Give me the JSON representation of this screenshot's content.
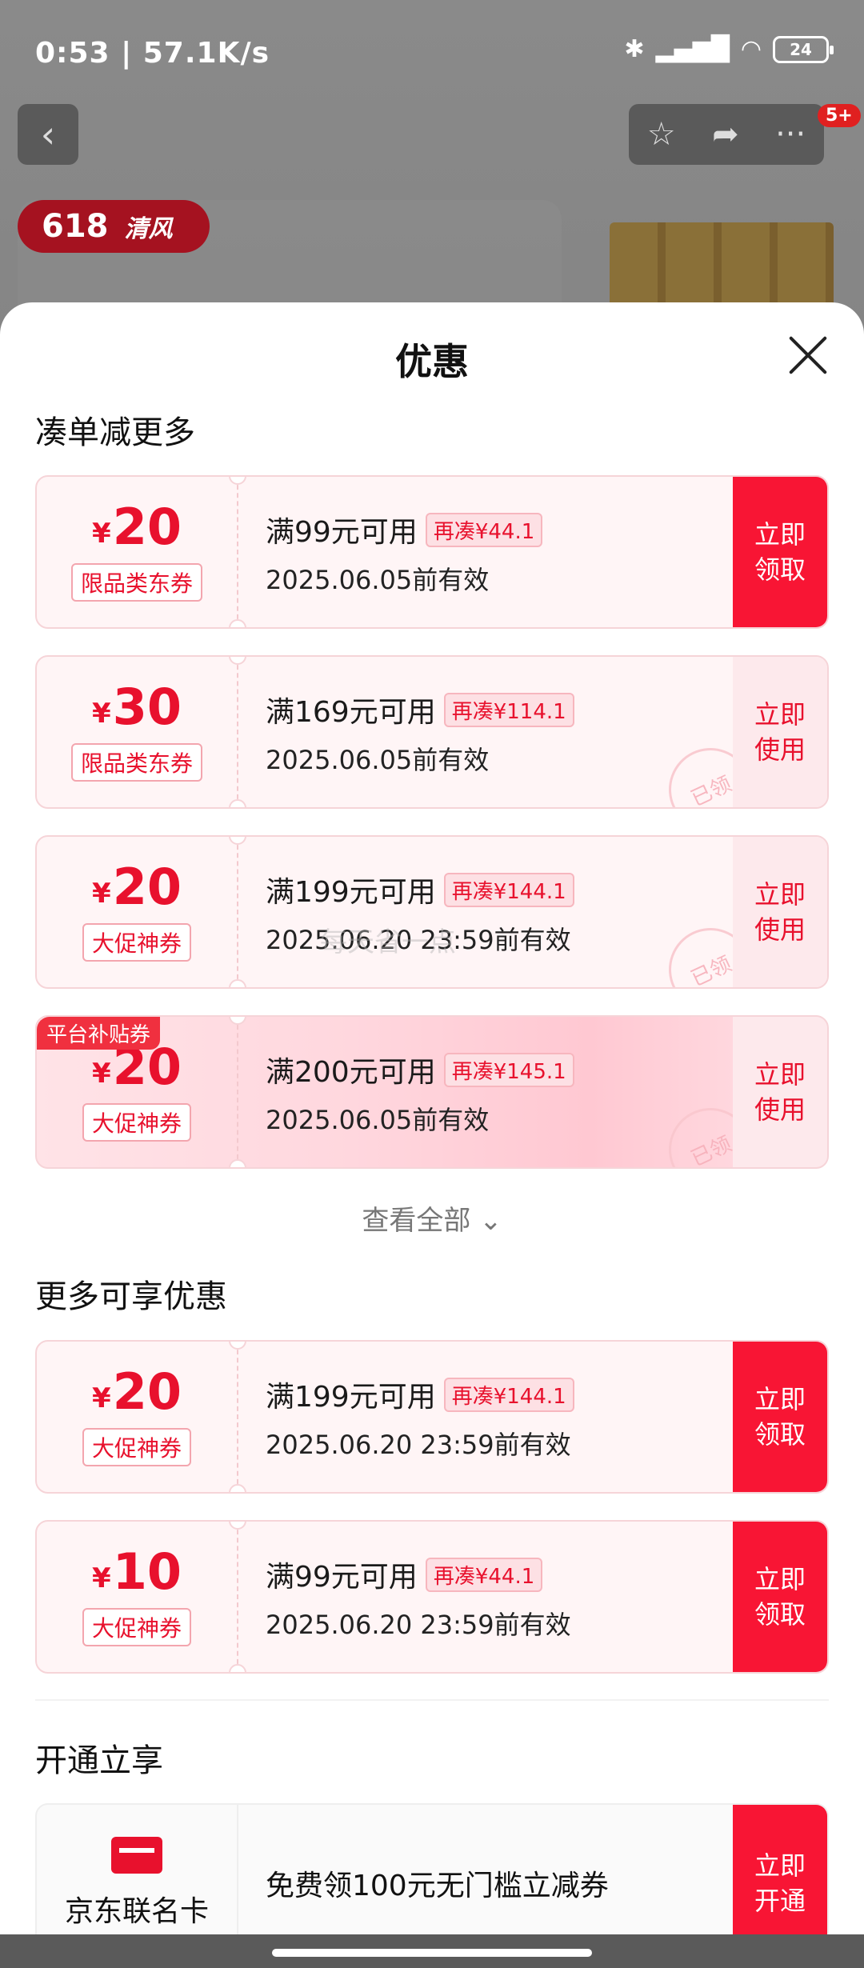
{
  "status": {
    "time": "0:53 | 57.1K/s",
    "battery": "24"
  },
  "background": {
    "badge_count": "5+",
    "promo_618": "618",
    "promo_brand": "清风"
  },
  "sheet": {
    "title": "优惠",
    "section1_title": "凑单减更多",
    "view_all": "查看全部",
    "section2_title": "更多可享优惠",
    "section3_title": "开通立享",
    "watermark": "每天省一点"
  },
  "coupons_group1": [
    {
      "currency": "¥",
      "amount": "20",
      "tag": "限品类东券",
      "condition": "满99元可用",
      "add_more": "再凑¥44.1",
      "expire": "2025.06.05前有效",
      "action_line1": "立即",
      "action_line2": "领取",
      "action_type": "primary"
    },
    {
      "currency": "¥",
      "amount": "30",
      "tag": "限品类东券",
      "condition": "满169元可用",
      "add_more": "再凑¥114.1",
      "expire": "2025.06.05前有效",
      "action_line1": "立即",
      "action_line2": "使用",
      "action_type": "secondary",
      "stamp": "已领"
    },
    {
      "currency": "¥",
      "amount": "20",
      "tag": "大促神券",
      "condition": "满199元可用",
      "add_more": "再凑¥144.1",
      "expire": "2025.06.20 23:59前有效",
      "action_line1": "立即",
      "action_line2": "使用",
      "action_type": "secondary",
      "stamp": "已领"
    },
    {
      "currency": "¥",
      "amount": "20",
      "tag": "大促神券",
      "condition": "满200元可用",
      "add_more": "再凑¥145.1",
      "expire": "2025.06.05前有效",
      "action_line1": "立即",
      "action_line2": "使用",
      "action_type": "secondary",
      "stamp": "已领",
      "platform_badge": "平台补贴券"
    }
  ],
  "coupons_group2": [
    {
      "currency": "¥",
      "amount": "20",
      "tag": "大促神券",
      "condition": "满199元可用",
      "add_more": "再凑¥144.1",
      "expire": "2025.06.20 23:59前有效",
      "action_line1": "立即",
      "action_line2": "领取",
      "action_type": "primary"
    },
    {
      "currency": "¥",
      "amount": "10",
      "tag": "大促神券",
      "condition": "满99元可用",
      "add_more": "再凑¥44.1",
      "expire": "2025.06.20 23:59前有效",
      "action_line1": "立即",
      "action_line2": "领取",
      "action_type": "primary"
    }
  ],
  "jd_card": {
    "name": "京东联名卡",
    "offer": "免费领100元无门槛立减券",
    "action_line1": "立即",
    "action_line2": "开通"
  },
  "colors": {
    "accent": "#f81534",
    "accent_text": "#e8112d",
    "coupon_bg": "#fff5f6"
  }
}
